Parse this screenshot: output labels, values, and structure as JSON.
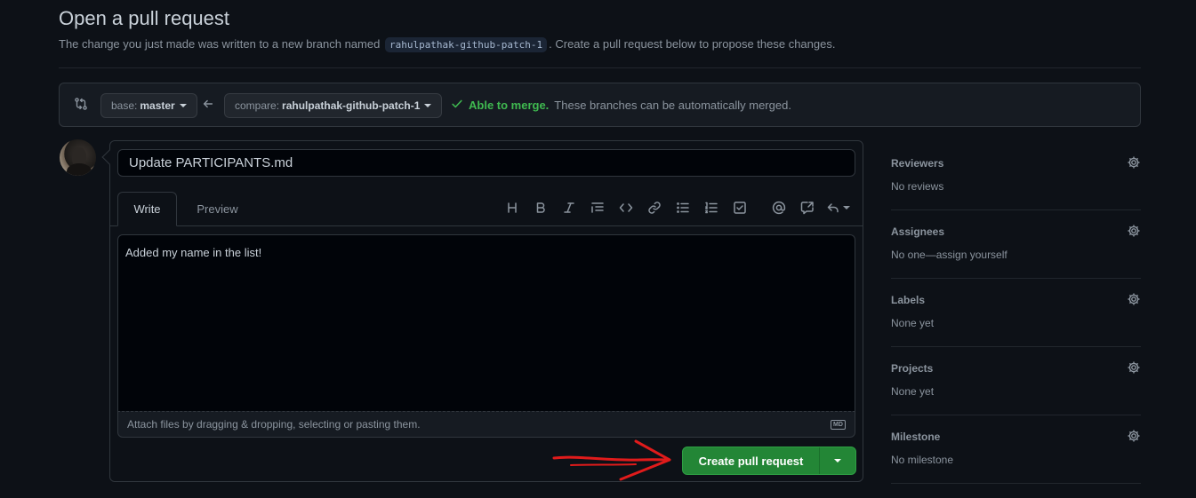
{
  "page": {
    "title": "Open a pull request",
    "subtitle_before": "The change you just made was written to a new branch named",
    "branch_name": "rahulpathak-github-patch-1",
    "subtitle_after": ". Create a pull request below to propose these changes."
  },
  "compare": {
    "base_prefix": "base:",
    "base_value": "master",
    "compare_prefix": "compare:",
    "compare_value": "rahulpathak-github-patch-1",
    "merge_ok": "Able to merge.",
    "merge_text": "These branches can be automatically merged.",
    "icons": [
      "git-compare-icon",
      "arrow-left-icon",
      "check-icon"
    ]
  },
  "composer": {
    "title_value": "Update PARTICIPANTS.md",
    "tabs": [
      {
        "label": "Write",
        "active": true
      },
      {
        "label": "Preview",
        "active": false
      }
    ],
    "toolbar_icons": [
      "heading-icon",
      "bold-icon",
      "italic-icon",
      "quote-icon",
      "code-icon",
      "link-icon",
      "unordered-list-icon",
      "ordered-list-icon",
      "task-list-icon",
      "mention-icon",
      "cross-reference-icon",
      "reply-icon"
    ],
    "body_value": "Added my name in the list!",
    "attach_text": "Attach files by dragging & dropping, selecting or pasting them.",
    "markdown_badge": "MD",
    "submit_label": "Create pull request"
  },
  "sidebar": {
    "sections": [
      {
        "heading": "Reviewers",
        "value": "No reviews"
      },
      {
        "heading": "Assignees",
        "value": "No one—assign yourself"
      },
      {
        "heading": "Labels",
        "value": "None yet"
      },
      {
        "heading": "Projects",
        "value": "None yet"
      },
      {
        "heading": "Milestone",
        "value": "No milestone"
      }
    ]
  },
  "colors": {
    "background": "#0d1117",
    "accent_green": "#238636",
    "merge_green": "#3fb950",
    "annotation_arrow": "#e01b1b"
  }
}
